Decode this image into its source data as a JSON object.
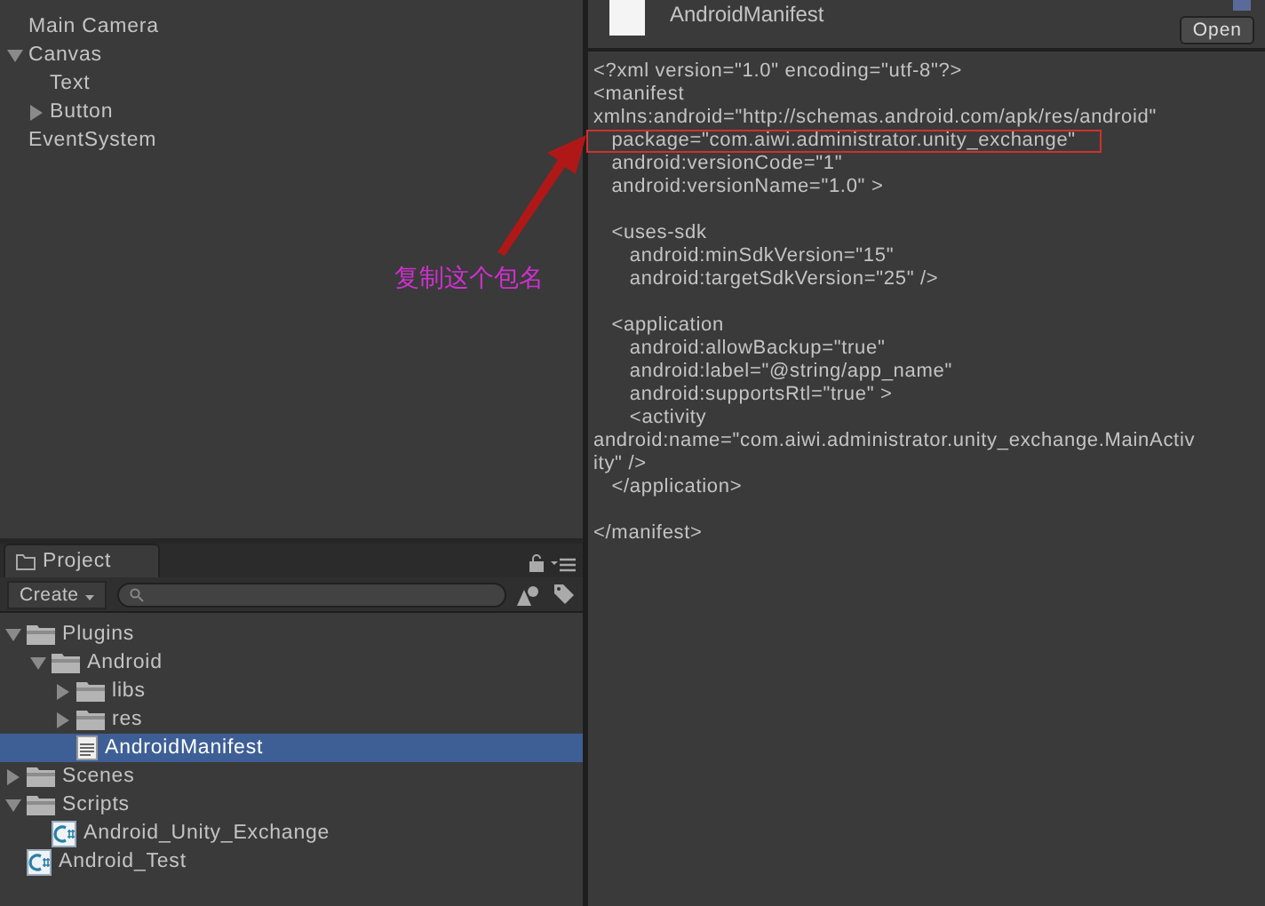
{
  "hierarchy": {
    "items": [
      {
        "kind": "leaf",
        "label": "Main Camera",
        "selected": false
      },
      {
        "kind": "group",
        "label": "Canvas",
        "expanded": true,
        "selected": false,
        "children": [
          {
            "kind": "leaf",
            "label": "Text",
            "selected": false
          },
          {
            "kind": "group",
            "label": "Button",
            "expanded": false,
            "selected": false
          }
        ]
      },
      {
        "kind": "leaf",
        "label": "EventSystem",
        "selected": false
      }
    ]
  },
  "annotation": {
    "note": "复制这个包名"
  },
  "project": {
    "tab": {
      "label": "Project",
      "selected": true
    },
    "create_button": "Create",
    "items": [
      {
        "kind": "folder",
        "label": "Plugins",
        "expanded": true,
        "selected": false,
        "children": [
          {
            "kind": "folder",
            "label": "Android",
            "expanded": true,
            "selected": false,
            "children": [
              {
                "kind": "folder",
                "label": "libs",
                "expanded": false,
                "selected": false
              },
              {
                "kind": "folder",
                "label": "res",
                "expanded": false,
                "selected": false
              },
              {
                "kind": "text",
                "label": "AndroidManifest",
                "selected": true
              }
            ]
          }
        ]
      },
      {
        "kind": "folder",
        "label": "Scenes",
        "expanded": false,
        "selected": false
      },
      {
        "kind": "folder",
        "label": "Scripts",
        "expanded": true,
        "selected": false,
        "children": [
          {
            "kind": "script",
            "label": "Android_Unity_Exchange",
            "selected": false
          }
        ]
      },
      {
        "kind": "script",
        "label": "Android_Test",
        "selected": false
      }
    ]
  },
  "inspector": {
    "title": "AndroidManifest",
    "open_button": "Open",
    "code_lines": [
      {
        "kind": "code",
        "text": "<?xml version=\"1.0\" encoding=\"utf-8\"?>",
        "annotated": false
      },
      {
        "kind": "code",
        "text": "<manifest",
        "annotated": false
      },
      {
        "kind": "code",
        "text": "xmlns:android=\"http://schemas.android.com/apk/res/android\"",
        "annotated": false
      },
      {
        "kind": "code",
        "text": "   package=\"com.aiwi.administrator.unity_exchange\"",
        "annotated": true
      },
      {
        "kind": "code",
        "text": "   android:versionCode=\"1\"",
        "annotated": false
      },
      {
        "kind": "code",
        "text": "   android:versionName=\"1.0\" >",
        "annotated": false
      },
      {
        "kind": "blank"
      },
      {
        "kind": "code",
        "text": "   <uses-sdk",
        "annotated": false
      },
      {
        "kind": "code",
        "text": "      android:minSdkVersion=\"15\"",
        "annotated": false
      },
      {
        "kind": "code",
        "text": "      android:targetSdkVersion=\"25\" />",
        "annotated": false
      },
      {
        "kind": "blank"
      },
      {
        "kind": "code",
        "text": "   <application",
        "annotated": false
      },
      {
        "kind": "code",
        "text": "      android:allowBackup=\"true\"",
        "annotated": false
      },
      {
        "kind": "code",
        "text": "      android:label=\"@string/app_name\"",
        "annotated": false
      },
      {
        "kind": "code",
        "text": "      android:supportsRtl=\"true\" >",
        "annotated": false
      },
      {
        "kind": "code",
        "text": "      <activity",
        "annotated": false
      },
      {
        "kind": "code",
        "text": "android:name=\"com.aiwi.administrator.unity_exchange.MainActiv",
        "annotated": false
      },
      {
        "kind": "code",
        "text": "ity\" />",
        "annotated": false
      },
      {
        "kind": "code",
        "text": "   </application>",
        "annotated": false
      },
      {
        "kind": "blank"
      },
      {
        "kind": "code",
        "text": "</manifest>",
        "annotated": false
      }
    ]
  }
}
